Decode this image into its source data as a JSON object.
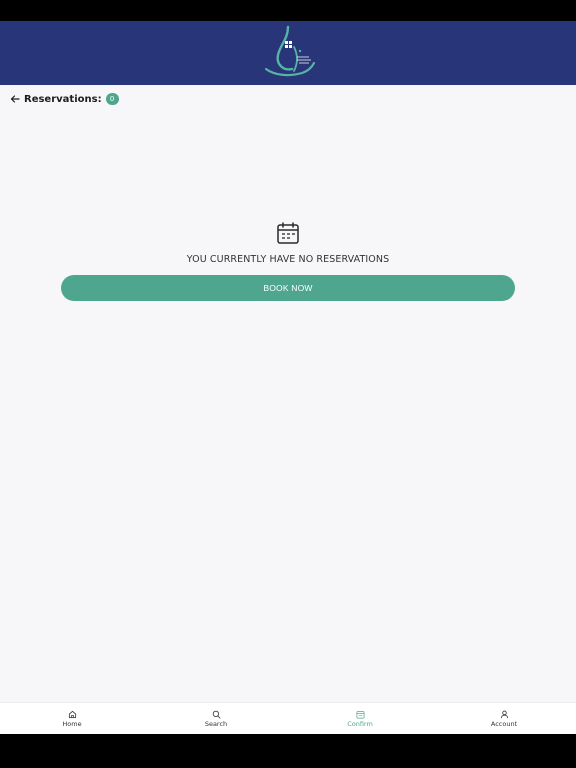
{
  "header": {
    "logo_icon": "app-logo-calligraphy"
  },
  "reservations": {
    "back_icon": "arrow-left-icon",
    "title": "Reservations:",
    "count": "0"
  },
  "empty_state": {
    "icon": "calendar-icon",
    "message": "YOU CURRENTLY HAVE NO RESERVATIONS",
    "button_label": "BOOK NOW"
  },
  "tabs": [
    {
      "label": "Home",
      "icon": "home-icon",
      "active": false
    },
    {
      "label": "Search",
      "icon": "search-icon",
      "active": false
    },
    {
      "label": "Confirm",
      "icon": "calendar-icon",
      "active": true
    },
    {
      "label": "Account",
      "icon": "user-icon",
      "active": false
    }
  ],
  "colors": {
    "header_bg": "#283578",
    "accent": "#4fa68e",
    "page_bg": "#f7f7f9"
  }
}
